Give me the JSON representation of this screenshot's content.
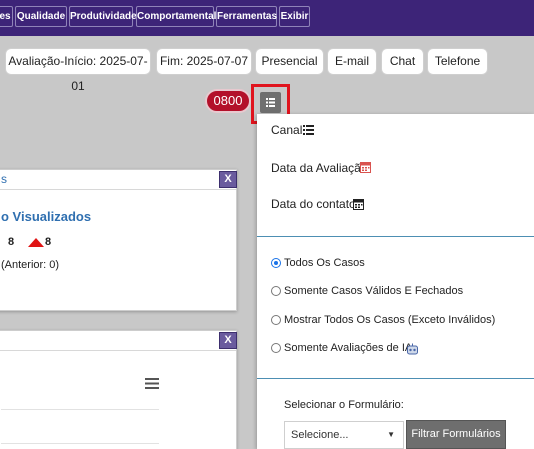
{
  "nav": {
    "items": [
      "es",
      "Qualidade",
      "Produtividade",
      "Comportamental",
      "Ferramentas",
      "Exibir"
    ]
  },
  "filters": {
    "pills": [
      "Avaliação-Início: 2025-07-01",
      "Fim: 2025-07-07",
      "Presencial",
      "E-mail",
      "Chat",
      "Telefone"
    ],
    "badge": "0800"
  },
  "panel1": {
    "head_text": "s",
    "close": "X",
    "title": "o Visualizados",
    "value_a": "8",
    "value_b": "8",
    "note": "(Anterior: 0)"
  },
  "panel2": {
    "close": "X"
  },
  "dropdown": {
    "canal_label": "Canal",
    "data_avaliacao_label": "Data da Avaliação",
    "data_contato_label": "Data do contato",
    "radios": [
      "Todos Os Casos",
      "Somente Casos Válidos E Fechados",
      "Mostrar Todos Os Casos (Exceto Inválidos)",
      "Somente Avaliações de IA"
    ],
    "selected_radio": "Todos Os Casos",
    "form_label": "Selecionar o Formulário:",
    "select_value": "Selecione...",
    "filter_button": "Filtrar Formulários"
  },
  "colors": {
    "nav_bg": "#3d2478",
    "badge_bg": "#b3102a",
    "highlight": "#e0141e",
    "title_blue": "#2f6fb0",
    "calendar_red": "#d9534f"
  }
}
